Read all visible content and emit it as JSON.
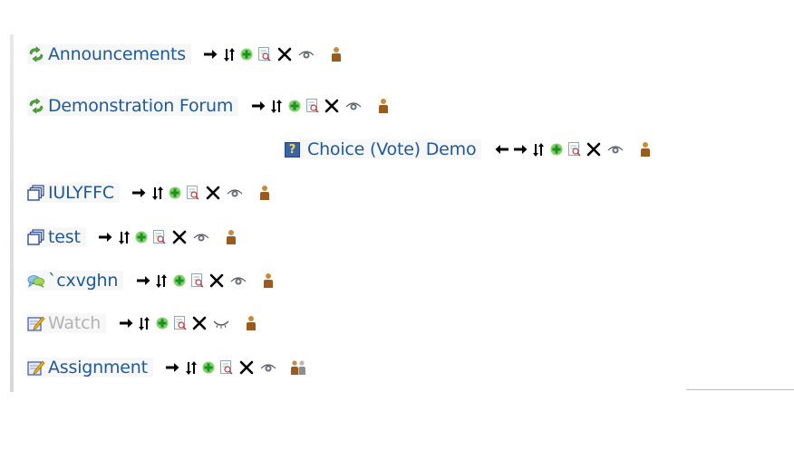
{
  "activities": [
    {
      "id": "announcements",
      "name": "Announcements",
      "icon": "forum-icon",
      "hidden": false,
      "indent": false
    },
    {
      "id": "demonstration-forum",
      "name": "Demonstration Forum",
      "icon": "forum-icon",
      "hidden": false,
      "indent": false
    },
    {
      "id": "choice-vote-demo",
      "name": "Choice (Vote) Demo",
      "icon": "choice-icon",
      "hidden": false,
      "indent": true
    },
    {
      "id": "iulyffc",
      "name": "IULYFFC",
      "icon": "resource-icon",
      "hidden": false,
      "indent": false
    },
    {
      "id": "test",
      "name": "test",
      "icon": "resource-icon",
      "hidden": false,
      "indent": false
    },
    {
      "id": "cxvghn",
      "name": "`cxvghn",
      "icon": "chat-icon",
      "hidden": false,
      "indent": false
    },
    {
      "id": "watch",
      "name": "Watch",
      "icon": "assignment-icon",
      "hidden": true,
      "indent": false
    },
    {
      "id": "assignment",
      "name": "Assignment",
      "icon": "assignment-icon",
      "hidden": false,
      "indent": false
    }
  ],
  "colors": {
    "link": "#1e5a9b",
    "dimmed_link": "#b3b3b3",
    "row_background": "#f7f7f7"
  }
}
